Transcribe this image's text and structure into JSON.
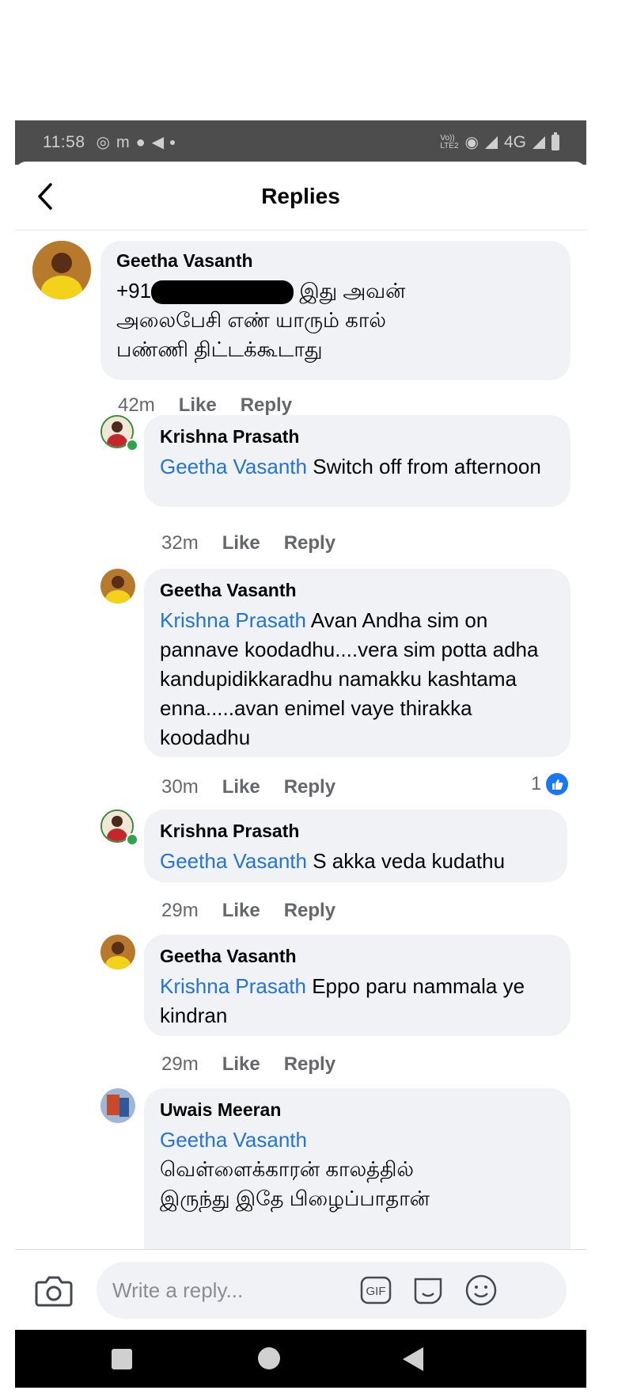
{
  "status_bar": {
    "time": "11:58",
    "network": "4G",
    "volte": "Vo))\nLTE2"
  },
  "header": {
    "title": "Replies"
  },
  "comments": [
    {
      "author": "Geetha Vasanth",
      "text_prefix": "+91",
      "text_line1_rest": " இது அவன்",
      "text_line2": "அலைபேசி எண் யாரும் கால்",
      "text_line3": "பண்ணி திட்டக்கூடாது",
      "time": "42m",
      "like": "Like",
      "reply": "Reply"
    },
    {
      "author": "Krishna Prasath",
      "mention": "Geetha Vasanth",
      "text": " Switch off from afternoon",
      "time": "32m",
      "like": "Like",
      "reply": "Reply"
    },
    {
      "author": "Geetha Vasanth",
      "mention": "Krishna Prasath",
      "text": " Avan Andha sim on pannave koodadhu....vera sim potta adha kandupidikkaradhu namakku kashtama enna.....avan enimel vaye thirakka koodadhu",
      "time": "30m",
      "like": "Like",
      "reply": "Reply",
      "reaction_count": "1"
    },
    {
      "author": "Krishna Prasath",
      "mention": "Geetha Vasanth",
      "text": " S akka veda kudathu",
      "time": "29m",
      "like": "Like",
      "reply": "Reply"
    },
    {
      "author": "Geetha Vasanth",
      "mention": "Krishna Prasath",
      "text": " Eppo paru nammala ye kindran",
      "time": "29m",
      "like": "Like",
      "reply": "Reply"
    },
    {
      "author": "Uwais Meeran",
      "mention": "Geetha Vasanth",
      "text_line1": "வெள்ளைக்காரன் காலத்தில்",
      "text_line2": "இருந்து இதே பிழைப்பாதான்"
    }
  ],
  "compose": {
    "placeholder": "Write a reply...",
    "gif_label": "GIF"
  },
  "colors": {
    "mention": "#2374d6",
    "bubble": "#f0f2f5",
    "like_blue": "#1877f2",
    "status_bar": "#4d4d4d"
  },
  "icons": [
    "back-arrow-icon",
    "camera-icon",
    "gif-icon",
    "sticker-icon",
    "emoji-icon",
    "like-icon",
    "home-icon",
    "recents-icon",
    "back-icon"
  ]
}
